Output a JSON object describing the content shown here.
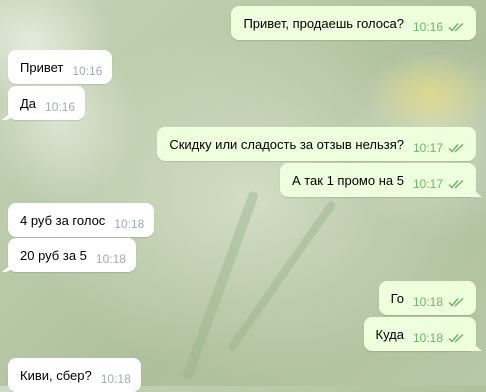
{
  "messages": [
    {
      "dir": "out",
      "text": "Привет, продаешь голоса?",
      "time": "10:16"
    },
    {
      "dir": "in",
      "text": "Привет",
      "time": "10:16"
    },
    {
      "dir": "in",
      "text": "Да",
      "time": "10:16"
    },
    {
      "dir": "out",
      "text": "Скидку или сладость за отзыв нельзя?",
      "time": "10:17"
    },
    {
      "dir": "out",
      "text": "А так 1 промо на 5",
      "time": "10:17"
    },
    {
      "dir": "in",
      "text": "4 руб за голос",
      "time": "10:18"
    },
    {
      "dir": "in",
      "text": "20 руб за 5",
      "time": "10:18"
    },
    {
      "dir": "out",
      "text": "Го",
      "time": "10:18"
    },
    {
      "dir": "out",
      "text": "Куда",
      "time": "10:18"
    },
    {
      "dir": "in",
      "text": "Киви, сбер?",
      "time": "10:18"
    }
  ],
  "colors": {
    "incoming": "#ffffff",
    "outgoing": "#eeffde",
    "time_out": "#6db567",
    "time_in": "#a0acb6"
  },
  "icons": {
    "read_receipt": "double-check-icon"
  }
}
